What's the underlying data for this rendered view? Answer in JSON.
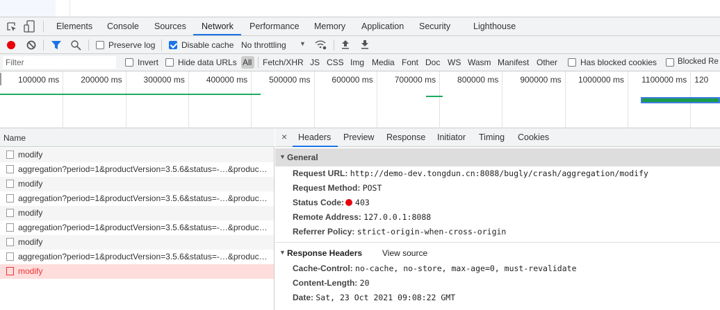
{
  "devtools": {
    "tabs": [
      "Elements",
      "Console",
      "Sources",
      "Network",
      "Performance",
      "Memory",
      "Application",
      "Security",
      "Lighthouse"
    ],
    "active_tab": "Network",
    "toolbar": {
      "preserve_log": {
        "label": "Preserve log",
        "checked": false
      },
      "disable_cache": {
        "label": "Disable cache",
        "checked": true
      },
      "throttling": "No throttling",
      "record_color": "#e8000b"
    },
    "filter": {
      "placeholder": "Filter",
      "invert": "Invert",
      "hide_data_urls": "Hide data URLs",
      "types": [
        "All",
        "Fetch/XHR",
        "JS",
        "CSS",
        "Img",
        "Media",
        "Font",
        "Doc",
        "WS",
        "Wasm",
        "Manifest",
        "Other"
      ],
      "active_type": "All",
      "has_blocked_cookies": "Has blocked cookies",
      "blocked_requests": "Blocked Re"
    },
    "timeline": {
      "ticks": [
        "100000 ms",
        "200000 ms",
        "300000 ms",
        "400000 ms",
        "500000 ms",
        "600000 ms",
        "700000 ms",
        "800000 ms",
        "900000 ms",
        "1000000 ms",
        "1100000 ms",
        "120"
      ]
    },
    "requests": {
      "header": "Name",
      "rows": [
        {
          "name": "modify",
          "error": false
        },
        {
          "name": "aggregation?period=1&productVersion=3.5.6&status=-…&produc…",
          "error": false
        },
        {
          "name": "modify",
          "error": false
        },
        {
          "name": "aggregation?period=1&productVersion=3.5.6&status=-…&produc…",
          "error": false
        },
        {
          "name": "modify",
          "error": false
        },
        {
          "name": "aggregation?period=1&productVersion=3.5.6&status=-…&produc…",
          "error": false
        },
        {
          "name": "modify",
          "error": false
        },
        {
          "name": "aggregation?period=1&productVersion=3.5.6&status=-…&produc…",
          "error": false
        },
        {
          "name": "modify",
          "error": true
        }
      ]
    },
    "detail": {
      "close": "×",
      "tabs": [
        "Headers",
        "Preview",
        "Response",
        "Initiator",
        "Timing",
        "Cookies"
      ],
      "active_tab": "Headers",
      "general": {
        "title": "General",
        "items": [
          {
            "k": "Request URL:",
            "v": "http://demo-dev.tongdun.cn:8088/bugly/crash/aggregation/modify"
          },
          {
            "k": "Request Method:",
            "v": "POST"
          },
          {
            "k": "Status Code:",
            "v": "403",
            "status_color": "#e8000b"
          },
          {
            "k": "Remote Address:",
            "v": "127.0.0.1:8088"
          },
          {
            "k": "Referrer Policy:",
            "v": "strict-origin-when-cross-origin"
          }
        ]
      },
      "response_headers": {
        "title": "Response Headers",
        "view_source": "View source",
        "items": [
          {
            "k": "Cache-Control:",
            "v": "no-cache, no-store, max-age=0, must-revalidate"
          },
          {
            "k": "Content-Length:",
            "v": "20"
          },
          {
            "k": "Date:",
            "v": "Sat, 23 Oct 2021 09:08:22 GMT"
          }
        ]
      }
    }
  }
}
